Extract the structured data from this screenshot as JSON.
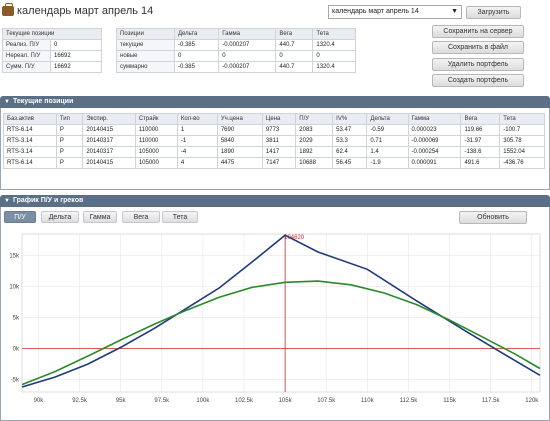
{
  "header": {
    "title": "календарь март апрель 14",
    "selected_portfolio": "календарь март апрель 14"
  },
  "buttons": {
    "load": "Загрузить",
    "save_server": "Сохранить на сервер",
    "save_file": "Сохранить в файл",
    "delete": "Удалить портфель",
    "create": "Создать портфель",
    "refresh": "Обновить"
  },
  "summary_positions": {
    "title": "Текущие позиции",
    "rows": [
      {
        "label": "Реализ. П/У",
        "value": "0"
      },
      {
        "label": "Нереал. П/У",
        "value": "16692"
      },
      {
        "label": "Сумм. П/У",
        "value": "16692"
      }
    ]
  },
  "greeks_table": {
    "headers": [
      "Позиции",
      "Дельта",
      "Гамма",
      "Вега",
      "Тета"
    ],
    "rows": [
      [
        "текущие",
        "-0.385",
        "-0.000207",
        "440.7",
        "1320.4"
      ],
      [
        "новые",
        "0",
        "0",
        "0",
        "0"
      ],
      [
        "суммарно",
        "-0.385",
        "-0.000207",
        "440.7",
        "1320.4"
      ]
    ]
  },
  "current_positions": {
    "title": "Текущие позиции",
    "headers": [
      "Баз.актив",
      "Тип",
      "Экспир.",
      "Страйк",
      "Кол-во",
      "Уч.цена",
      "Цена",
      "П/У",
      "IV%",
      "Дельта",
      "Гамма",
      "Вега",
      "Тета"
    ],
    "rows": [
      [
        "RTS-6.14",
        "P",
        "20140415",
        "110000",
        "1",
        "7690",
        "9773",
        "2083",
        "53.47",
        "-0.59",
        "0.000023",
        "119.66",
        "-100.7"
      ],
      [
        "RTS-3.14",
        "P",
        "20140317",
        "110000",
        "-1",
        "5840",
        "3811",
        "2029",
        "53.3",
        "0.71",
        "-0.000069",
        "-31.97",
        "305.78"
      ],
      [
        "RTS-3.14",
        "P",
        "20140317",
        "105000",
        "-4",
        "1890",
        "1417",
        "1892",
        "62.4",
        "1.4",
        "-0.000254",
        "-138.6",
        "1552.04"
      ],
      [
        "RTS-6.14",
        "P",
        "20140415",
        "105000",
        "4",
        "4475",
        "7147",
        "10688",
        "56.45",
        "-1.9",
        "0.000091",
        "491.6",
        "-436.76"
      ]
    ]
  },
  "chart_panel": {
    "title": "График П/У и греков",
    "tabs": [
      "П/У",
      "Дельта",
      "Гамма",
      "Вега",
      "Тета"
    ],
    "active_tab": "П/У"
  },
  "chart_data": {
    "type": "line",
    "x_tick_labels": [
      "90k",
      "92.5k",
      "95k",
      "97.5k",
      "100k",
      "102.5k",
      "105k",
      "107.5k",
      "110k",
      "112.5k",
      "115k",
      "117.5k",
      "120k"
    ],
    "y_tick_labels": [
      "15k",
      "10k",
      "5k",
      "0k",
      "-5k"
    ],
    "xlim": [
      89000,
      120500
    ],
    "ylim": [
      -7000,
      18500
    ],
    "marker": {
      "x": 105000,
      "label": "104620"
    },
    "series": [
      {
        "color": "#1f3a7a",
        "x": [
          89000,
          91000,
          93000,
          95000,
          97000,
          99000,
          101000,
          103000,
          105000,
          107000,
          110000,
          113000,
          116000,
          118000,
          120500
        ],
        "y": [
          -6200,
          -4600,
          -2500,
          200,
          3200,
          6500,
          9800,
          14000,
          18300,
          15600,
          12800,
          7700,
          2800,
          -400,
          -4300
        ]
      },
      {
        "color": "#2a8a2a",
        "x": [
          89000,
          91000,
          93000,
          95000,
          97000,
          99000,
          101000,
          103000,
          105000,
          107000,
          109000,
          111000,
          113000,
          115000,
          117000,
          119000,
          120500
        ],
        "y": [
          -5800,
          -3700,
          -1200,
          1400,
          3900,
          6200,
          8300,
          9900,
          10700,
          10900,
          10300,
          9000,
          7100,
          4600,
          1900,
          -900,
          -3200
        ]
      }
    ],
    "colors": {
      "zero_line": "#cc2a2a",
      "marker_line": "#cc2a2a",
      "grid": "#e6e6e6"
    }
  }
}
